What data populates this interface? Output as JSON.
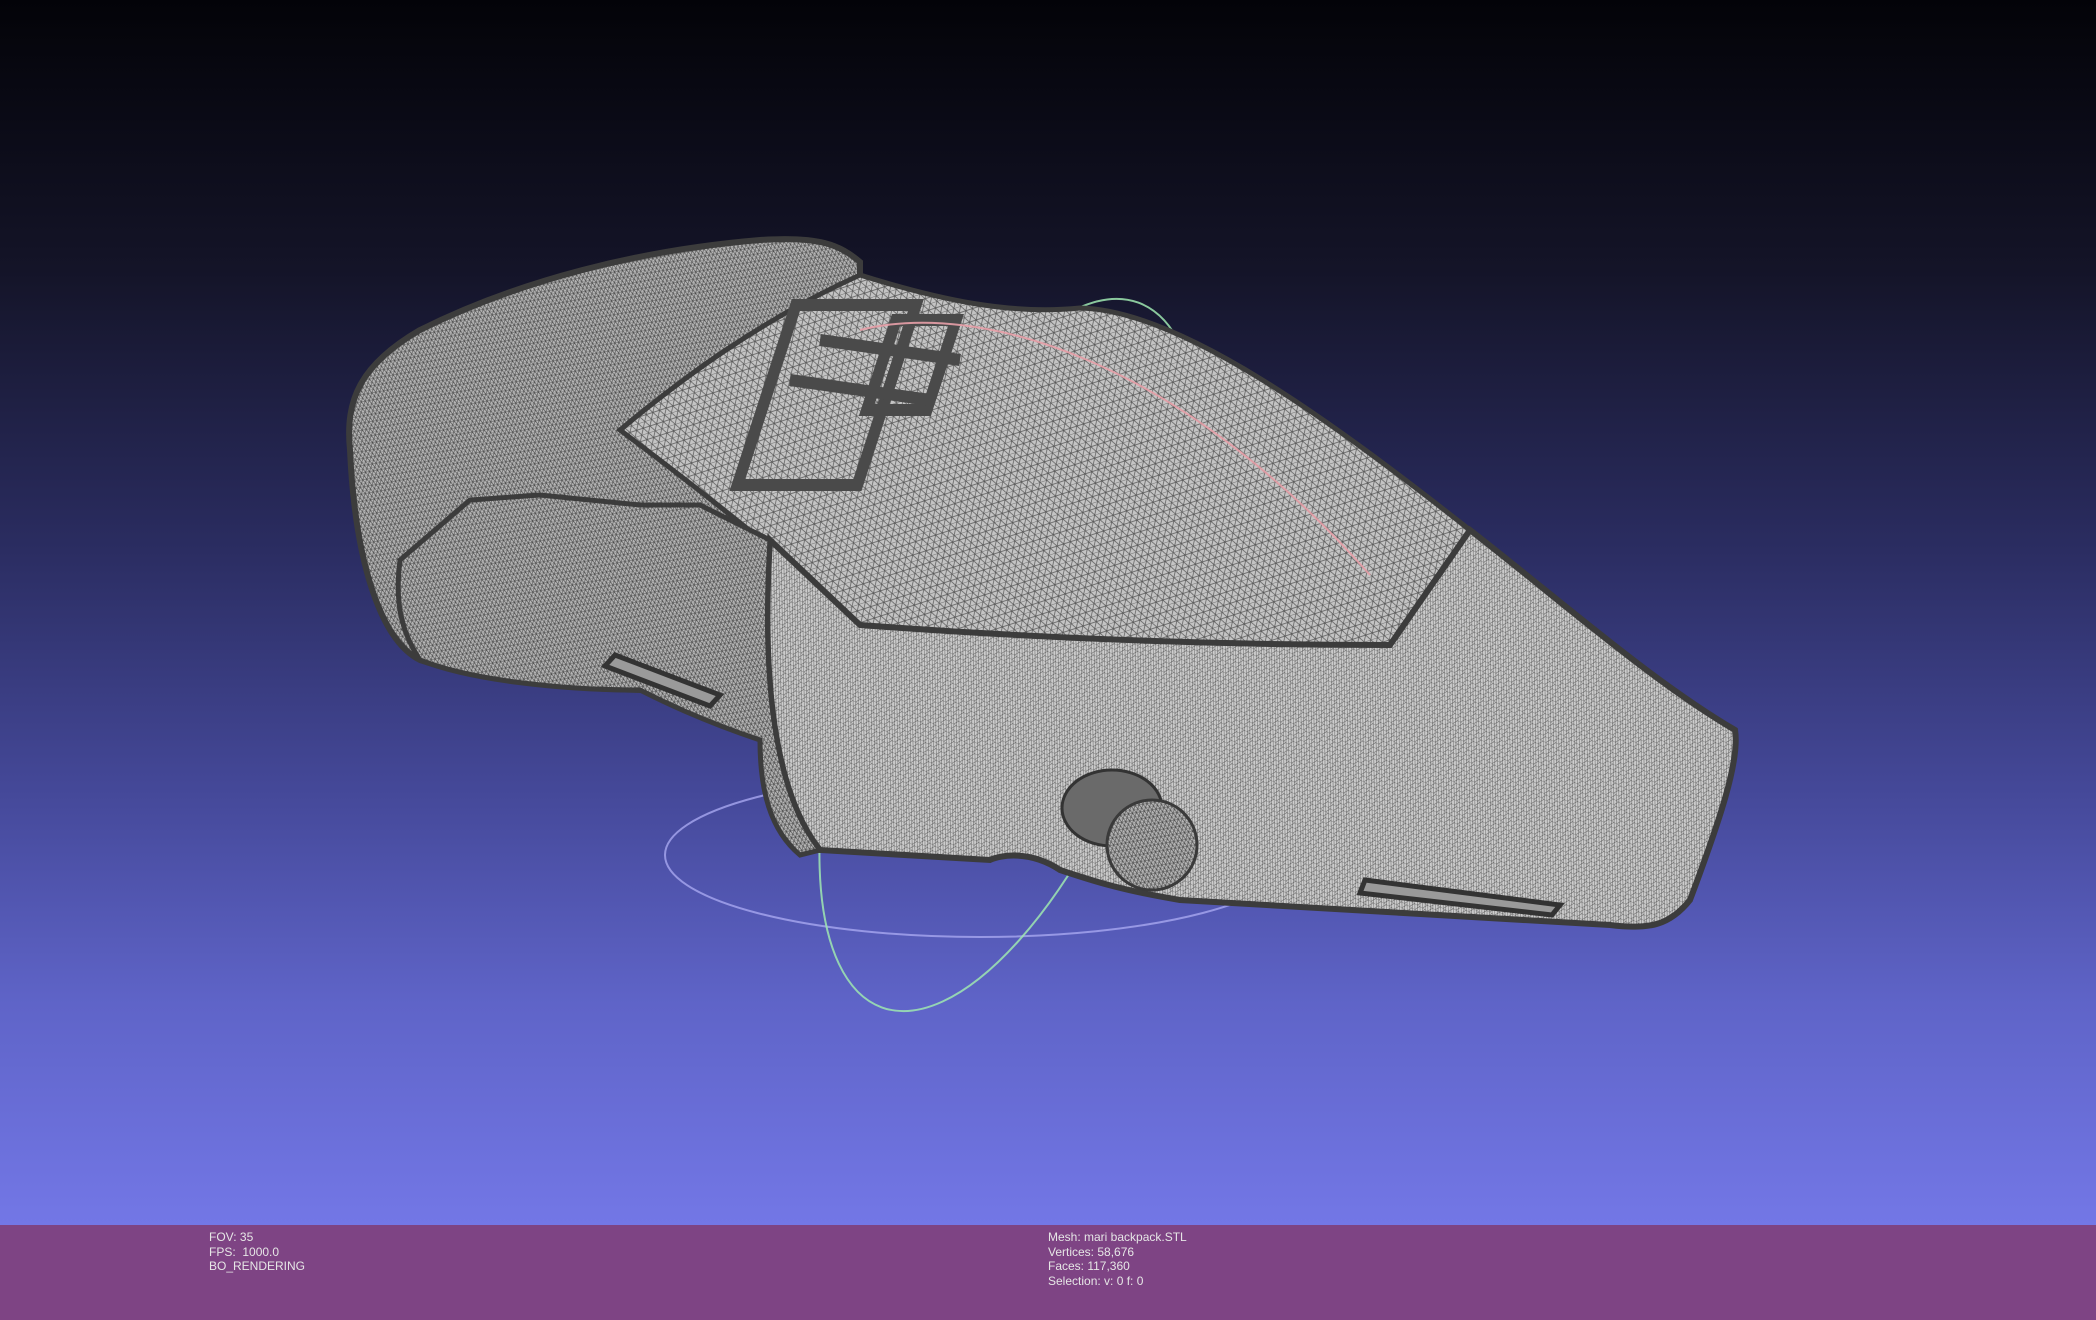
{
  "viewport": {
    "background_top": "#030308",
    "background_bottom": "#7377e6",
    "mesh_fill": "#c0c0c0",
    "mesh_edge": "#404040",
    "trackball_colors": {
      "x_ring": "#e8a0a8",
      "y_ring": "#9fe8b0",
      "z_ring": "#a8a8f0"
    }
  },
  "status_bar": {
    "background": "#7e4484",
    "render_info": {
      "fov": "FOV: 35",
      "fps": "FPS:  1000.0",
      "mode": "BO_RENDERING"
    },
    "mesh_info": {
      "mesh": "Mesh: mari backpack.STL",
      "vertices": "Vertices: 58,676",
      "faces": "Faces: 117,360",
      "selection": "Selection: v: 0 f: 0"
    }
  }
}
